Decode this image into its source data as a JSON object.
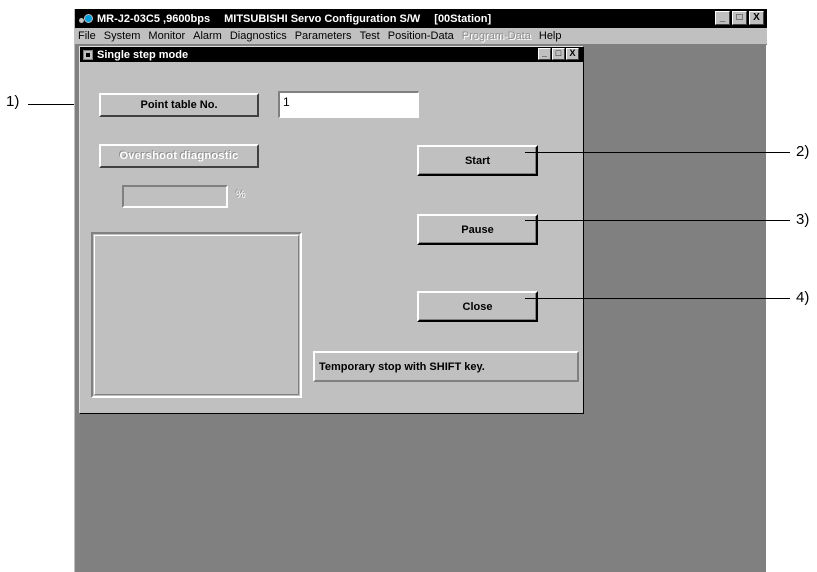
{
  "app": {
    "title_parts": [
      "MR-J2-03C5 ,9600bps",
      "MITSUBISHI Servo Configuration S/W",
      "[00Station]"
    ],
    "window_buttons": [
      "_",
      "□",
      "X"
    ]
  },
  "menu": [
    {
      "label": "File",
      "enabled": true
    },
    {
      "label": "System",
      "enabled": true
    },
    {
      "label": "Monitor",
      "enabled": true
    },
    {
      "label": "Alarm",
      "enabled": true
    },
    {
      "label": "Diagnostics",
      "enabled": true
    },
    {
      "label": "Parameters",
      "enabled": true
    },
    {
      "label": "Test",
      "enabled": true
    },
    {
      "label": "Position-Data",
      "enabled": true
    },
    {
      "label": "Program-Data",
      "enabled": false
    },
    {
      "label": "Help",
      "enabled": true
    }
  ],
  "dialog": {
    "title": "Single step mode",
    "window_buttons": [
      "_",
      "□",
      "X"
    ],
    "point_table_label": "Point table No.",
    "point_table_value": "1",
    "overshoot_label": "Overshoot diagnostic",
    "overshoot_value": "",
    "percent_unit": "%",
    "start_button": "Start",
    "pause_button": "Pause",
    "close_button": "Close",
    "status_text": "Temporary stop with SHIFT key."
  },
  "callouts": [
    "1)",
    "2)",
    "3)",
    "4)"
  ],
  "colors": {
    "titlebar": "#000000",
    "face": "#c0c0c0",
    "workspace": "#808080",
    "disabled_menu": "#909090"
  }
}
